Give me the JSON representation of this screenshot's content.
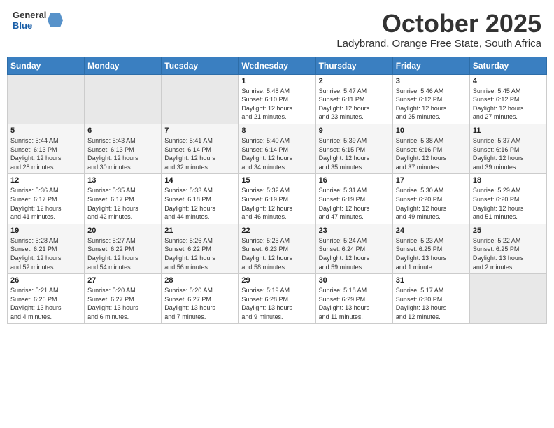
{
  "header": {
    "logo_general": "General",
    "logo_blue": "Blue",
    "month": "October 2025",
    "location": "Ladybrand, Orange Free State, South Africa"
  },
  "weekdays": [
    "Sunday",
    "Monday",
    "Tuesday",
    "Wednesday",
    "Thursday",
    "Friday",
    "Saturday"
  ],
  "weeks": [
    [
      {
        "day": "",
        "info": ""
      },
      {
        "day": "",
        "info": ""
      },
      {
        "day": "",
        "info": ""
      },
      {
        "day": "1",
        "info": "Sunrise: 5:48 AM\nSunset: 6:10 PM\nDaylight: 12 hours\nand 21 minutes."
      },
      {
        "day": "2",
        "info": "Sunrise: 5:47 AM\nSunset: 6:11 PM\nDaylight: 12 hours\nand 23 minutes."
      },
      {
        "day": "3",
        "info": "Sunrise: 5:46 AM\nSunset: 6:12 PM\nDaylight: 12 hours\nand 25 minutes."
      },
      {
        "day": "4",
        "info": "Sunrise: 5:45 AM\nSunset: 6:12 PM\nDaylight: 12 hours\nand 27 minutes."
      }
    ],
    [
      {
        "day": "5",
        "info": "Sunrise: 5:44 AM\nSunset: 6:13 PM\nDaylight: 12 hours\nand 28 minutes."
      },
      {
        "day": "6",
        "info": "Sunrise: 5:43 AM\nSunset: 6:13 PM\nDaylight: 12 hours\nand 30 minutes."
      },
      {
        "day": "7",
        "info": "Sunrise: 5:41 AM\nSunset: 6:14 PM\nDaylight: 12 hours\nand 32 minutes."
      },
      {
        "day": "8",
        "info": "Sunrise: 5:40 AM\nSunset: 6:14 PM\nDaylight: 12 hours\nand 34 minutes."
      },
      {
        "day": "9",
        "info": "Sunrise: 5:39 AM\nSunset: 6:15 PM\nDaylight: 12 hours\nand 35 minutes."
      },
      {
        "day": "10",
        "info": "Sunrise: 5:38 AM\nSunset: 6:16 PM\nDaylight: 12 hours\nand 37 minutes."
      },
      {
        "day": "11",
        "info": "Sunrise: 5:37 AM\nSunset: 6:16 PM\nDaylight: 12 hours\nand 39 minutes."
      }
    ],
    [
      {
        "day": "12",
        "info": "Sunrise: 5:36 AM\nSunset: 6:17 PM\nDaylight: 12 hours\nand 41 minutes."
      },
      {
        "day": "13",
        "info": "Sunrise: 5:35 AM\nSunset: 6:17 PM\nDaylight: 12 hours\nand 42 minutes."
      },
      {
        "day": "14",
        "info": "Sunrise: 5:33 AM\nSunset: 6:18 PM\nDaylight: 12 hours\nand 44 minutes."
      },
      {
        "day": "15",
        "info": "Sunrise: 5:32 AM\nSunset: 6:19 PM\nDaylight: 12 hours\nand 46 minutes."
      },
      {
        "day": "16",
        "info": "Sunrise: 5:31 AM\nSunset: 6:19 PM\nDaylight: 12 hours\nand 47 minutes."
      },
      {
        "day": "17",
        "info": "Sunrise: 5:30 AM\nSunset: 6:20 PM\nDaylight: 12 hours\nand 49 minutes."
      },
      {
        "day": "18",
        "info": "Sunrise: 5:29 AM\nSunset: 6:20 PM\nDaylight: 12 hours\nand 51 minutes."
      }
    ],
    [
      {
        "day": "19",
        "info": "Sunrise: 5:28 AM\nSunset: 6:21 PM\nDaylight: 12 hours\nand 52 minutes."
      },
      {
        "day": "20",
        "info": "Sunrise: 5:27 AM\nSunset: 6:22 PM\nDaylight: 12 hours\nand 54 minutes."
      },
      {
        "day": "21",
        "info": "Sunrise: 5:26 AM\nSunset: 6:22 PM\nDaylight: 12 hours\nand 56 minutes."
      },
      {
        "day": "22",
        "info": "Sunrise: 5:25 AM\nSunset: 6:23 PM\nDaylight: 12 hours\nand 58 minutes."
      },
      {
        "day": "23",
        "info": "Sunrise: 5:24 AM\nSunset: 6:24 PM\nDaylight: 12 hours\nand 59 minutes."
      },
      {
        "day": "24",
        "info": "Sunrise: 5:23 AM\nSunset: 6:25 PM\nDaylight: 13 hours\nand 1 minute."
      },
      {
        "day": "25",
        "info": "Sunrise: 5:22 AM\nSunset: 6:25 PM\nDaylight: 13 hours\nand 2 minutes."
      }
    ],
    [
      {
        "day": "26",
        "info": "Sunrise: 5:21 AM\nSunset: 6:26 PM\nDaylight: 13 hours\nand 4 minutes."
      },
      {
        "day": "27",
        "info": "Sunrise: 5:20 AM\nSunset: 6:27 PM\nDaylight: 13 hours\nand 6 minutes."
      },
      {
        "day": "28",
        "info": "Sunrise: 5:20 AM\nSunset: 6:27 PM\nDaylight: 13 hours\nand 7 minutes."
      },
      {
        "day": "29",
        "info": "Sunrise: 5:19 AM\nSunset: 6:28 PM\nDaylight: 13 hours\nand 9 minutes."
      },
      {
        "day": "30",
        "info": "Sunrise: 5:18 AM\nSunset: 6:29 PM\nDaylight: 13 hours\nand 11 minutes."
      },
      {
        "day": "31",
        "info": "Sunrise: 5:17 AM\nSunset: 6:30 PM\nDaylight: 13 hours\nand 12 minutes."
      },
      {
        "day": "",
        "info": ""
      }
    ]
  ]
}
